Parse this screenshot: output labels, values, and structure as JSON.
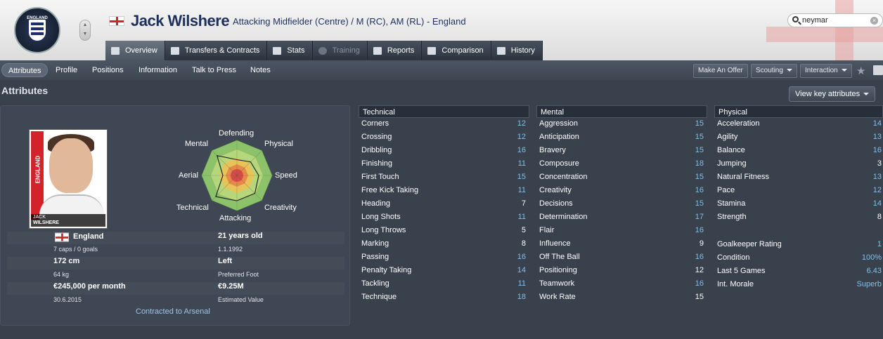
{
  "header": {
    "player_name": "Jack Wilshere",
    "positions": "Attacking Midfielder (Centre) / M (RC), AM (RL) - England",
    "badge_text": "ENGLAND",
    "search_value": "neymar"
  },
  "tabs": [
    {
      "label": "Overview",
      "active": true
    },
    {
      "label": "Transfers & Contracts"
    },
    {
      "label": "Stats"
    },
    {
      "label": "Training",
      "dim": true
    },
    {
      "label": "Reports"
    },
    {
      "label": "Comparison"
    },
    {
      "label": "History"
    }
  ],
  "subnav": {
    "items": [
      "Attributes",
      "Profile",
      "Positions",
      "Information",
      "Talk to Press",
      "Notes"
    ],
    "make_offer": "Make An Offer",
    "scouting": "Scouting",
    "interaction": "Interaction"
  },
  "page_title": "Attributes",
  "view_key_attributes": "View key attributes",
  "profile": {
    "photo_caption_1": "JACK",
    "photo_caption_2": "WILSHERE",
    "photo_strip": "ENGLAND",
    "nation": "England",
    "caps": "7 caps / 0 goals",
    "height": "172 cm",
    "weight": "64 kg",
    "wage": "€245,000 per month",
    "contract_end": "30.6.2015",
    "age": "21 years old",
    "dob": "1.1.1992",
    "foot": "Left",
    "foot_label": "Preferred Foot",
    "value": "€9.25M",
    "value_label": "Estimated Value",
    "contract": "Contracted to Arsenal"
  },
  "radar": {
    "labels": [
      "Defending",
      "Physical",
      "Speed",
      "Creativity",
      "Attacking",
      "Technical",
      "Aerial",
      "Mental"
    ],
    "values": [
      0.45,
      0.55,
      0.62,
      0.72,
      0.72,
      0.85,
      0.4,
      0.8
    ],
    "colors": {
      "ring1": "#8cc36a",
      "ring2": "#b5d67a",
      "ring3": "#e7c45a",
      "ring4": "#e68a4a",
      "core": "#d94a4a"
    }
  },
  "technical": {
    "title": "Technical",
    "rows": [
      [
        "Corners",
        "12",
        1
      ],
      [
        "Crossing",
        "12",
        1
      ],
      [
        "Dribbling",
        "16",
        1
      ],
      [
        "Finishing",
        "11",
        1
      ],
      [
        "First Touch",
        "15",
        1
      ],
      [
        "Free Kick Taking",
        "11",
        1
      ],
      [
        "Heading",
        "7",
        0
      ],
      [
        "Long Shots",
        "11",
        1
      ],
      [
        "Long Throws",
        "5",
        0
      ],
      [
        "Marking",
        "8",
        0
      ],
      [
        "Passing",
        "16",
        1
      ],
      [
        "Penalty Taking",
        "14",
        1
      ],
      [
        "Tackling",
        "11",
        1
      ],
      [
        "Technique",
        "18",
        1
      ]
    ]
  },
  "mental": {
    "title": "Mental",
    "rows": [
      [
        "Aggression",
        "15",
        1
      ],
      [
        "Anticipation",
        "15",
        1
      ],
      [
        "Bravery",
        "15",
        1
      ],
      [
        "Composure",
        "18",
        1
      ],
      [
        "Concentration",
        "15",
        1
      ],
      [
        "Creativity",
        "16",
        1
      ],
      [
        "Decisions",
        "15",
        1
      ],
      [
        "Determination",
        "17",
        1
      ],
      [
        "Flair",
        "16",
        1
      ],
      [
        "Influence",
        "9",
        0
      ],
      [
        "Off The Ball",
        "16",
        1
      ],
      [
        "Positioning",
        "12",
        0
      ],
      [
        "Teamwork",
        "16",
        1
      ],
      [
        "Work Rate",
        "15",
        0
      ]
    ]
  },
  "physical": {
    "title": "Physical",
    "rows": [
      [
        "Acceleration",
        "14",
        1
      ],
      [
        "Agility",
        "13",
        1
      ],
      [
        "Balance",
        "16",
        1
      ],
      [
        "Jumping",
        "3",
        0
      ],
      [
        "Natural Fitness",
        "13",
        1
      ],
      [
        "Pace",
        "12",
        1
      ],
      [
        "Stamina",
        "14",
        1
      ],
      [
        "Strength",
        "8",
        0
      ]
    ],
    "extra": [
      [
        "Goalkeeper Rating",
        "1",
        1
      ],
      [
        "Condition",
        "100%",
        1
      ],
      [
        "Last 5 Games",
        "6.43",
        1
      ],
      [
        "Int. Morale",
        "Superb",
        1
      ]
    ]
  }
}
